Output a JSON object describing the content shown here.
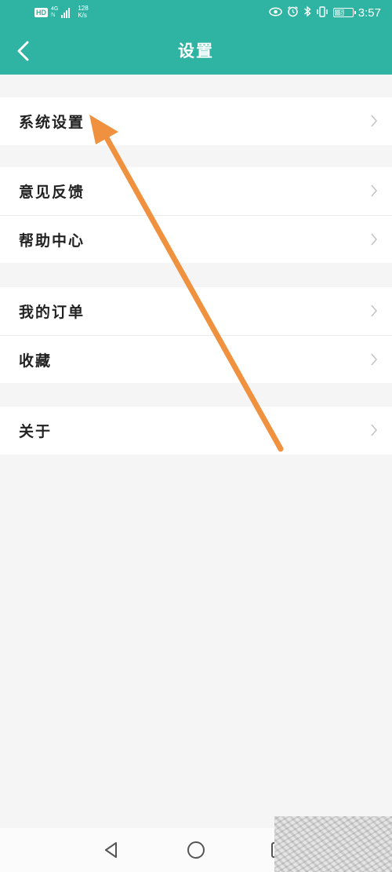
{
  "status_bar": {
    "hd": "HD",
    "network_type": "4G",
    "network_sub": "ℕ",
    "speed_value": "128",
    "speed_unit": "K/s",
    "battery_level": "51",
    "time": "3:57"
  },
  "header": {
    "title": "设置",
    "back_icon": "chevron-left-icon"
  },
  "menu_groups": [
    {
      "items": [
        {
          "label": "系统设置"
        }
      ]
    },
    {
      "items": [
        {
          "label": "意见反馈"
        },
        {
          "label": "帮助中心"
        }
      ]
    },
    {
      "items": [
        {
          "label": "我的订单"
        },
        {
          "label": "收藏"
        }
      ]
    },
    {
      "items": [
        {
          "label": "关于"
        }
      ]
    }
  ],
  "colors": {
    "accent": "#2fb3a3",
    "background": "#f5f5f5",
    "annotation_arrow": "#f0913f"
  },
  "system_nav": {
    "icons": [
      "back-triangle-icon",
      "home-circle-icon",
      "recents-square-icon"
    ]
  }
}
